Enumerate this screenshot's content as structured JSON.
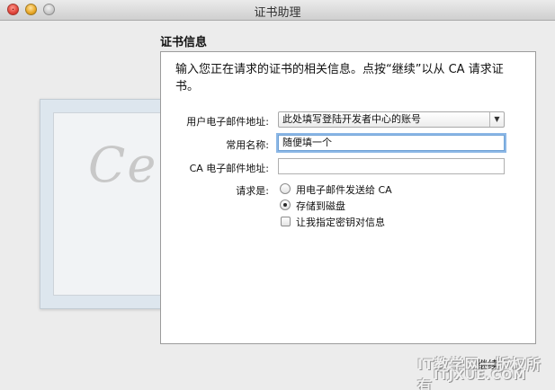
{
  "window": {
    "title": "证书助理"
  },
  "certificate_art": {
    "word": "Certificate"
  },
  "section": {
    "heading": "证书信息"
  },
  "panel": {
    "description": "输入您正在请求的证书的相关信息。点按“继续”以从 CA 请求证书。"
  },
  "form": {
    "email_label": "用户电子邮件地址:",
    "email_value": "此处填写登陆开发者中心的账号",
    "common_name_label": "常用名称:",
    "common_name_value": "随便填一个",
    "ca_email_label": "CA 电子邮件地址:",
    "ca_email_value": "",
    "request_label": "请求是:",
    "options": [
      {
        "label": "用电子邮件发送给 CA",
        "selected": false
      },
      {
        "label": "存储到磁盘",
        "selected": true
      }
    ],
    "key_pair_label": "让我指定密钥对信息",
    "key_pair_checked": false
  },
  "footer": {
    "continue_label": "继续"
  },
  "watermark": {
    "line1": "IT教学网一版权所有",
    "line2": "ITJXUE.COM"
  },
  "colors": {
    "focus_ring": "#8cb7e6",
    "close": "#e0443a",
    "minimize": "#e8a624",
    "zoom": "#c9c9c9"
  }
}
